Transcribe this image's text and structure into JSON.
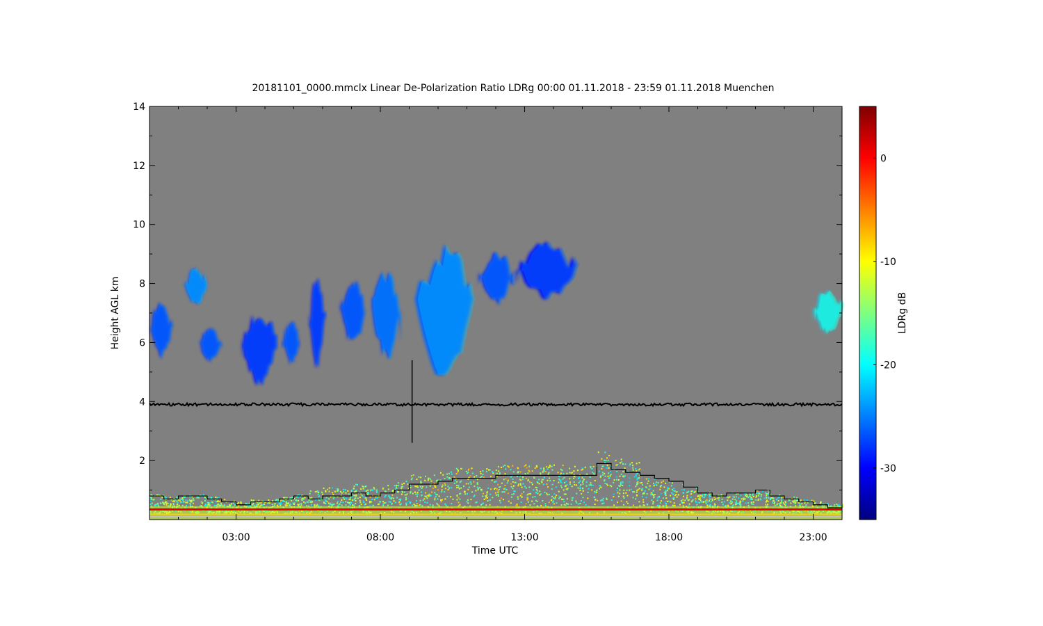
{
  "chart_data": {
    "type": "heatmap",
    "title": "20181101_0000.mmclx Linear De-Polarization Ratio LDRg   00:00 01.11.2018 - 23:59 01.11.2018 Muenchen",
    "xlabel": "Time UTC",
    "ylabel": "Height AGL km",
    "colorbar_label": "LDRg dB",
    "xlim_hours": [
      0.0,
      24.0
    ],
    "ylim_km": [
      0.0,
      14.0
    ],
    "x_ticks": [
      {
        "value": 3,
        "label": "03:00"
      },
      {
        "value": 8,
        "label": "08:00"
      },
      {
        "value": 13,
        "label": "13:00"
      },
      {
        "value": 18,
        "label": "18:00"
      },
      {
        "value": 23,
        "label": "23:00"
      }
    ],
    "y_ticks": [
      {
        "value": 2,
        "label": "2"
      },
      {
        "value": 4,
        "label": "4"
      },
      {
        "value": 6,
        "label": "6"
      },
      {
        "value": 8,
        "label": "8"
      },
      {
        "value": 10,
        "label": "10"
      },
      {
        "value": 12,
        "label": "12"
      },
      {
        "value": 14,
        "label": "14"
      }
    ],
    "colorbar_range_db": [
      -35,
      5
    ],
    "colorbar_ticks": [
      {
        "value": 0,
        "label": "0"
      },
      {
        "value": -10,
        "label": "-10"
      },
      {
        "value": -20,
        "label": "-20"
      },
      {
        "value": -30,
        "label": "-30"
      }
    ],
    "colormap": [
      "#00007f",
      "#0000ff",
      "#007fff",
      "#00ffff",
      "#7fff7f",
      "#ffff00",
      "#ff7f00",
      "#ff0000",
      "#7f0000"
    ],
    "background_color": "#808080",
    "line_at_4km": 3.9,
    "cloud_regions": [
      {
        "t0": 0.0,
        "t1": 0.8,
        "bottom": 5.4,
        "top": 7.5,
        "ldr": -28
      },
      {
        "t0": 1.2,
        "t1": 2.0,
        "bottom": 7.2,
        "top": 8.6,
        "ldr": -26
      },
      {
        "t0": 1.7,
        "t1": 2.5,
        "bottom": 5.3,
        "top": 6.6,
        "ldr": -28
      },
      {
        "t0": 3.2,
        "t1": 4.4,
        "bottom": 4.4,
        "top": 7.2,
        "ldr": -29
      },
      {
        "t0": 4.6,
        "t1": 5.2,
        "bottom": 5.2,
        "top": 6.8,
        "ldr": -28
      },
      {
        "t0": 5.5,
        "t1": 6.1,
        "bottom": 5.0,
        "top": 8.4,
        "ldr": -29
      },
      {
        "t0": 6.6,
        "t1": 7.5,
        "bottom": 5.8,
        "top": 8.2,
        "ldr": -28
      },
      {
        "t0": 7.7,
        "t1": 8.7,
        "bottom": 5.3,
        "top": 8.5,
        "ldr": -27
      },
      {
        "t0": 9.2,
        "t1": 11.2,
        "bottom": 4.4,
        "top": 9.4,
        "ldr": -26
      },
      {
        "t0": 11.4,
        "t1": 12.6,
        "bottom": 7.2,
        "top": 9.2,
        "ldr": -28
      },
      {
        "t0": 12.7,
        "t1": 14.8,
        "bottom": 7.4,
        "top": 9.5,
        "ldr": -29
      },
      {
        "t0": 23.0,
        "t1": 24.0,
        "bottom": 6.2,
        "top": 7.9,
        "ldr": -21
      }
    ],
    "boundary_layer_step": {
      "hours": [
        0,
        0.5,
        1,
        2,
        2.5,
        3,
        3.5,
        4,
        4.5,
        5,
        5.5,
        6,
        6.5,
        7,
        7.5,
        8,
        8.5,
        9,
        9.5,
        10,
        10.5,
        11,
        11.5,
        12,
        12.5,
        13,
        13.5,
        14,
        14.5,
        15,
        15.5,
        16,
        16.5,
        17,
        17.5,
        18,
        18.5,
        19,
        19.5,
        20,
        20.5,
        21,
        21.5,
        22,
        22.5,
        23,
        23.5,
        24
      ],
      "height_km": [
        0.8,
        0.7,
        0.8,
        0.7,
        0.6,
        0.5,
        0.6,
        0.6,
        0.7,
        0.8,
        0.7,
        0.8,
        0.8,
        0.9,
        0.8,
        0.9,
        1.0,
        1.2,
        1.2,
        1.3,
        1.4,
        1.4,
        1.4,
        1.5,
        1.5,
        1.5,
        1.5,
        1.5,
        1.5,
        1.5,
        1.9,
        1.7,
        1.6,
        1.5,
        1.4,
        1.3,
        1.1,
        0.9,
        0.8,
        0.9,
        0.9,
        1.0,
        0.8,
        0.7,
        0.6,
        0.5,
        0.4,
        0.5
      ]
    },
    "surface_clutter": {
      "height_km_bottom": 0.0,
      "height_km_top": 0.45
    }
  }
}
